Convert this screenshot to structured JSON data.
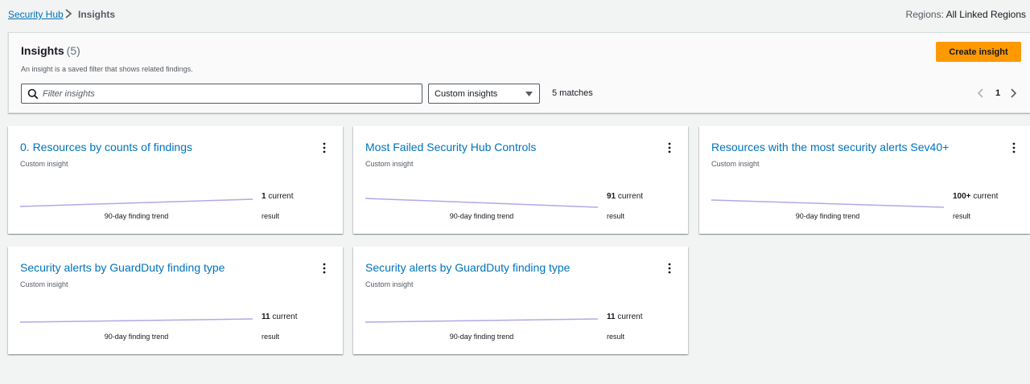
{
  "breadcrumb": {
    "root": "Security Hub",
    "current": "Insights"
  },
  "regions": {
    "label": "Regions:",
    "value": "All Linked Regions"
  },
  "header": {
    "title": "Insights",
    "count": "(5)",
    "description": "An insight is a saved filter that shows related findings.",
    "create_label": "Create insight"
  },
  "filter": {
    "search_placeholder": "Filter insights",
    "select_value": "Custom insights",
    "matches": "5 matches"
  },
  "pagination": {
    "current_page": "1"
  },
  "colors": {
    "accent": "#ff9900",
    "link": "#0073bb",
    "trend_line": "#b4a7e8"
  },
  "cards": [
    {
      "title": "0. Resources by counts of findings",
      "subtitle": "Custom insight",
      "trend_label": "90-day finding trend",
      "result_value": "1",
      "result_suffix": "current",
      "result_label": "result",
      "trend": "up"
    },
    {
      "title": "Most Failed Security Hub Controls",
      "subtitle": "Custom insight",
      "trend_label": "90-day finding trend",
      "result_value": "91",
      "result_suffix": "current",
      "result_label": "result",
      "trend": "down"
    },
    {
      "title": "Resources with the most security alerts Sev40+",
      "subtitle": "Custom insight",
      "trend_label": "90-day finding trend",
      "result_value": "100+",
      "result_suffix": "current",
      "result_label": "result",
      "trend": "down"
    },
    {
      "title": "Security alerts by GuardDuty finding type",
      "subtitle": "Custom insight",
      "trend_label": "90-day finding trend",
      "result_value": "11",
      "result_suffix": "current",
      "result_label": "result",
      "trend": "up-slight"
    },
    {
      "title": "Security alerts by GuardDuty finding type",
      "subtitle": "Custom insight",
      "trend_label": "90-day finding trend",
      "result_value": "11",
      "result_suffix": "current",
      "result_label": "result",
      "trend": "up-slight"
    }
  ]
}
